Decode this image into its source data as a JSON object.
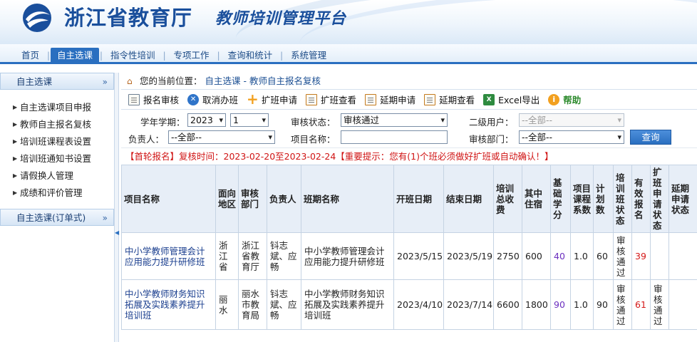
{
  "header": {
    "org": "浙江省教育厅",
    "platform": "教师培训管理平台"
  },
  "nav": {
    "items": [
      "首页",
      "自主选课",
      "指令性培训",
      "专项工作",
      "查询和统计",
      "系统管理"
    ],
    "active_index": 1
  },
  "sidebar": {
    "section1": "自主选课",
    "items": [
      "自主选课项目申报",
      "教师自主报名复核",
      "培训班课程表设置",
      "培训班通知书设置",
      "请假换人管理",
      "成绩和评价管理"
    ],
    "section2": "自主选课(订单式)"
  },
  "breadcrumb": {
    "prefix": "您的当前位置：",
    "path": "自主选课 - 教师自主报名复核"
  },
  "toolbar": {
    "review": "报名审核",
    "cancel": "取消办班",
    "expand_apply": "扩班申请",
    "expand_view": "扩班查看",
    "extend_apply": "延期申请",
    "extend_view": "延期查看",
    "excel": "Excel导出",
    "help": "帮助"
  },
  "filters": {
    "year_label": "学年学期：",
    "year_value": "2023",
    "term_value": "1",
    "status_label": "审核状态：",
    "status_value": "审核通过",
    "user_label": "二级用户：",
    "user_value": "--全部--",
    "person_label": "负责人：",
    "person_value": "--全部--",
    "project_label": "项目名称：",
    "project_value": "",
    "dept_label": "审核部门：",
    "dept_value": "--全部--",
    "query": "查询"
  },
  "notice": "【首轮报名】复核时间：2023-02-20至2023-02-24【重要提示：您有(1)个班必须做好扩班或自动确认！】",
  "table": {
    "headers": [
      "项目名称",
      "面向地区",
      "审核部门",
      "负责人",
      "班期名称",
      "开班日期",
      "结束日期",
      "培训总收费",
      "其中住宿",
      "基础学分",
      "项目课程系数",
      "计划数",
      "培训班状态",
      "有效报名",
      "扩班申请状态",
      "延期申请状态"
    ],
    "rows": [
      {
        "project": "中小学教师管理会计应用能力提升研修班",
        "region": "浙江省",
        "dept": "浙江省教育厅",
        "person": "钭志斌、应畅",
        "class": "中小学教师管理会计应用能力提升研修班",
        "start": "2023/5/15",
        "end": "2023/5/19",
        "fee": "2750",
        "lodging": "600",
        "credit": "40",
        "coef": "1.0",
        "plan": "60",
        "status": "审核通过",
        "valid": "39",
        "expand": "",
        "extend": ""
      },
      {
        "project": "中小学教师财务知识拓展及实践素养提升培训班",
        "region": "丽水",
        "dept": "丽水市教育局",
        "person": "钭志斌、应畅",
        "class": "中小学教师财务知识拓展及实践素养提升培训班",
        "start": "2023/4/10",
        "end": "2023/7/14",
        "fee": "6600",
        "lodging": "1800",
        "credit": "90",
        "coef": "1.0",
        "plan": "90",
        "status": "审核通过",
        "valid": "61",
        "expand": "审核通过",
        "extend": ""
      }
    ]
  }
}
